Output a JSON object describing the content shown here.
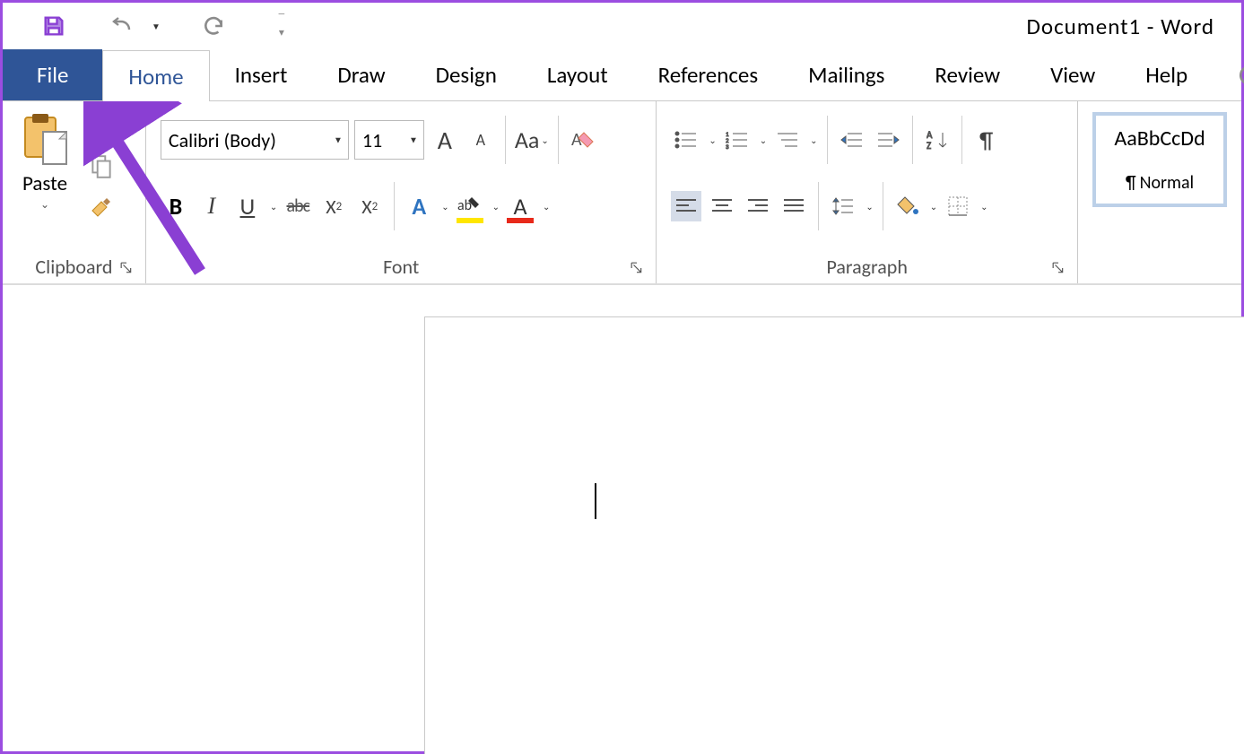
{
  "titlebar": {
    "document_title": "Document1  -  Word"
  },
  "tabs": {
    "file": "File",
    "home": "Home",
    "insert": "Insert",
    "draw": "Draw",
    "design": "Design",
    "layout": "Layout",
    "references": "References",
    "mailings": "Mailings",
    "review": "Review",
    "view": "View",
    "help": "Help"
  },
  "clipboard": {
    "paste": "Paste",
    "group_label": "Clipboard"
  },
  "font": {
    "font_name": "Calibri (Body)",
    "font_size": "11",
    "group_label": "Font",
    "grow_label": "A",
    "shrink_label": "A",
    "case_label": "Aa",
    "bold": "B",
    "italic": "I",
    "underline": "U",
    "strike": "abc",
    "subscript": "X",
    "subscript_sub": "2",
    "superscript": "X",
    "superscript_sup": "2",
    "texteffect": "A",
    "highlight": "ab",
    "fontcolor": "A"
  },
  "paragraph": {
    "group_label": "Paragraph"
  },
  "styles": {
    "sample": "AaBbCcDd",
    "normal": "Normal"
  }
}
